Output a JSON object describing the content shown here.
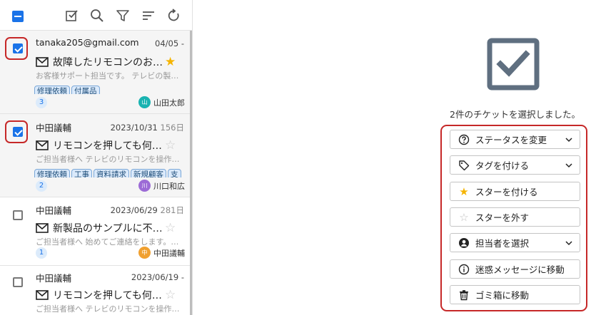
{
  "toolbar": {
    "icons": [
      "select-all-checkbox",
      "checklist-icon",
      "search-icon",
      "filter-icon",
      "sort-icon",
      "refresh-icon"
    ]
  },
  "tickets": [
    {
      "sender": "tanaka205@gmail.com",
      "date": "04/05 -",
      "days": "",
      "subject": "故障したリモコンのお…",
      "preview": "お客様サポート担当です。 テレビの製…",
      "tags": [
        "修理依頼",
        "付属品"
      ],
      "count": "3",
      "assignee_initial": "山",
      "assignee_name": "山田太郎",
      "avatar_color": "#19b3b1",
      "starred": true,
      "checked": true
    },
    {
      "sender": "中田議輔",
      "date": "2023/10/31 ",
      "days": "156日",
      "subject": "リモコンを押しても何…",
      "preview": "ご担当者様へ テレビのリモコンを操作…",
      "tags": [
        "修理依頼",
        "工事",
        "資料請求",
        "新規顧客",
        "支"
      ],
      "count": "2",
      "assignee_initial": "川",
      "assignee_name": "川口和広",
      "avatar_color": "#9c6bd6",
      "starred": false,
      "checked": true
    },
    {
      "sender": "中田議輔",
      "date": "2023/06/29 ",
      "days": "281日",
      "subject": "新製品のサンプルに不…",
      "preview": "ご担当者様へ 始めてご連絡をします。…",
      "tags": [],
      "count": "1",
      "assignee_initial": "中",
      "assignee_name": "中田議輔",
      "avatar_color": "#f0a030",
      "starred": false,
      "checked": false
    },
    {
      "sender": "中田議輔",
      "date": "2023/06/19 -",
      "days": "",
      "subject": "リモコンを押しても何…",
      "preview": "ご担当者様へ テレビのリモコンを操作…",
      "tags": [],
      "count": "",
      "assignee_initial": "",
      "assignee_name": "",
      "avatar_color": "",
      "starred": false,
      "checked": false
    }
  ],
  "selection": {
    "message": "2件のチケットを選択しました。"
  },
  "actions": [
    {
      "label": "ステータスを変更",
      "icon": "help-circle-icon",
      "dropdown": true
    },
    {
      "label": "タグを付ける",
      "icon": "tag-icon",
      "dropdown": true
    },
    {
      "label": "スターを付ける",
      "icon": "star-filled-icon",
      "dropdown": false
    },
    {
      "label": "スターを外す",
      "icon": "star-outline-icon",
      "dropdown": false
    },
    {
      "label": "担当者を選択",
      "icon": "person-circle-icon",
      "dropdown": true
    },
    {
      "label": "迷惑メッセージに移動",
      "icon": "info-circle-icon",
      "dropdown": false
    },
    {
      "label": "ゴミ箱に移動",
      "icon": "trash-icon",
      "dropdown": false
    }
  ],
  "colors": {
    "accent": "#1a73e8",
    "highlight_border": "#c62828",
    "star": "#f5b400",
    "big_check": "#5f6f80"
  }
}
